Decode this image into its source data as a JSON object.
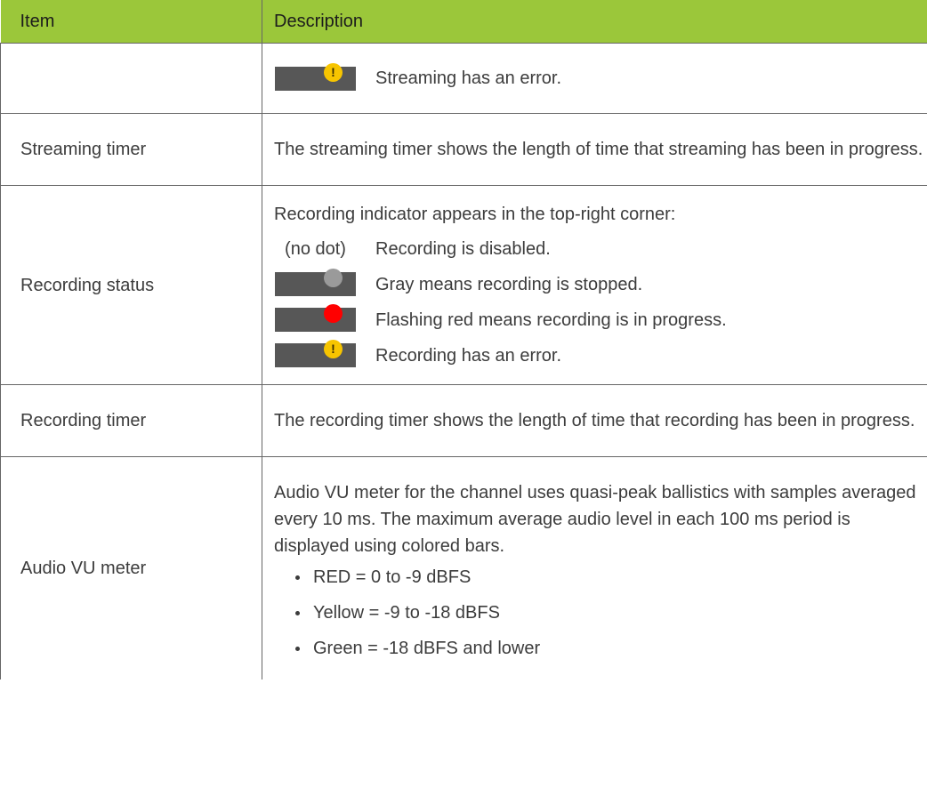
{
  "header": {
    "item": "Item",
    "description": "Description"
  },
  "rows": [
    {
      "item": "",
      "indicators": [
        {
          "dot": "warn",
          "text": "Streaming has an error."
        }
      ]
    },
    {
      "item": "Streaming timer",
      "description": "The streaming timer shows the length of time that streaming has been in progress."
    },
    {
      "item": "Recording status",
      "intro": "Recording indicator appears in the top-right corner:",
      "indicators": [
        {
          "dot": "none",
          "label": "(no dot)",
          "text": "Recording is disabled."
        },
        {
          "dot": "gray",
          "text": "Gray means recording is stopped."
        },
        {
          "dot": "red",
          "text": "Flashing red means recording is in progress."
        },
        {
          "dot": "warn",
          "text": "Recording has an error."
        }
      ]
    },
    {
      "item": "Recording timer",
      "description": "The recording timer shows the length of time that recording has been in progress."
    },
    {
      "item": "Audio VU meter",
      "description": "Audio VU meter for the channel uses quasi-peak ballistics with samples averaged every 10 ms. The maximum average audio level in each 100 ms period is displayed using colored bars.",
      "levels": [
        "RED = 0 to -9 dBFS",
        "Yellow = -9 to -18 dBFS",
        "Green = -18 dBFS and lower"
      ]
    }
  ],
  "icons": {
    "warning_glyph": "!"
  },
  "colors": {
    "header_bg": "#9bc73a",
    "indicator_bg": "#575757",
    "dot_gray": "#9a9a9a",
    "dot_red": "#ff0000",
    "dot_warn": "#f7c500"
  }
}
